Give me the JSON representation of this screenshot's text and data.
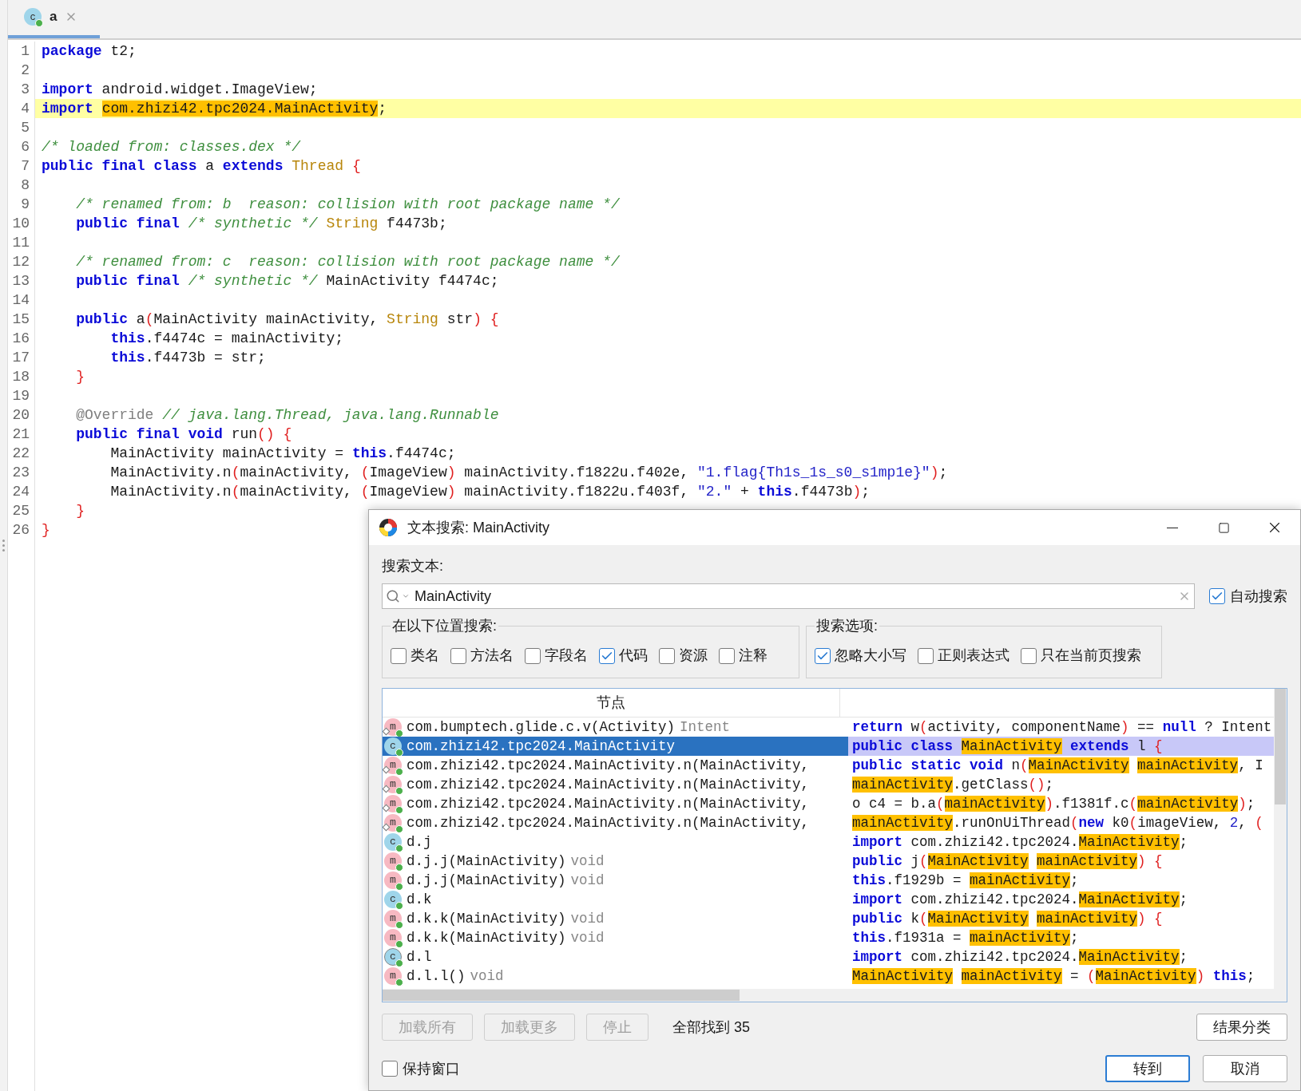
{
  "editor": {
    "tab": {
      "icon": "c",
      "label": "a",
      "selected": true
    },
    "lines": [
      {
        "number": "1",
        "highlighted": false,
        "tokens": [
          {
            "kind": "keyword",
            "text": "package"
          },
          {
            "kind": "plain",
            "text": " t2;"
          }
        ]
      },
      {
        "number": "2",
        "highlighted": false
      },
      {
        "number": "3",
        "highlighted": false,
        "tokens": [
          {
            "kind": "keyword",
            "text": "import"
          },
          {
            "kind": "plain",
            "text": " android.widget.ImageView;"
          }
        ]
      },
      {
        "number": "4",
        "highlighted": true,
        "tokens": [
          {
            "kind": "keyword",
            "text": "import "
          },
          {
            "kind": "match",
            "text": "com.zhizi42.tpc2024.MainActivity"
          },
          {
            "kind": "plain",
            "text": ";"
          }
        ]
      },
      {
        "number": "5",
        "highlighted": false
      },
      {
        "number": "6",
        "highlighted": false,
        "tokens": [
          {
            "kind": "comment",
            "text": "/* loaded from: classes.dex */"
          }
        ]
      },
      {
        "number": "7",
        "highlighted": false,
        "tokens": [
          {
            "kind": "keyword",
            "text": "public final class"
          },
          {
            "kind": "plain",
            "text": " a "
          },
          {
            "kind": "keyword",
            "text": "extends "
          },
          {
            "kind": "type",
            "text": "Thread "
          },
          {
            "kind": "brace",
            "text": "{"
          }
        ]
      },
      {
        "number": "8",
        "highlighted": false
      },
      {
        "number": "9",
        "highlighted": false,
        "tokens": [
          {
            "kind": "comment",
            "text": "    /* renamed from: b  reason: collision with root package name */"
          }
        ]
      },
      {
        "number": "10",
        "highlighted": false,
        "tokens": [
          {
            "kind": "keyword",
            "text": "    public final "
          },
          {
            "kind": "comment",
            "text": "/* synthetic */ "
          },
          {
            "kind": "type",
            "text": "String"
          },
          {
            "kind": "plain",
            "text": " f4473b;"
          }
        ]
      },
      {
        "number": "11",
        "highlighted": false
      },
      {
        "number": "12",
        "highlighted": false,
        "tokens": [
          {
            "kind": "comment",
            "text": "    /* renamed from: c  reason: collision with root package name */"
          }
        ]
      },
      {
        "number": "13",
        "highlighted": false,
        "tokens": [
          {
            "kind": "keyword",
            "text": "    public final "
          },
          {
            "kind": "comment",
            "text": "/* synthetic */"
          },
          {
            "kind": "plain",
            "text": " MainActivity f4474c;"
          }
        ]
      },
      {
        "number": "14",
        "highlighted": false
      },
      {
        "number": "15",
        "highlighted": false,
        "tokens": [
          {
            "kind": "keyword",
            "text": "    public"
          },
          {
            "kind": "plain",
            "text": " a"
          },
          {
            "kind": "brace",
            "text": "("
          },
          {
            "kind": "plain",
            "text": "MainActivity mainActivity, "
          },
          {
            "kind": "type",
            "text": "String"
          },
          {
            "kind": "plain",
            "text": " str"
          },
          {
            "kind": "brace",
            "text": ") {"
          }
        ]
      },
      {
        "number": "16",
        "highlighted": false,
        "tokens": [
          {
            "kind": "keyword",
            "text": "        this"
          },
          {
            "kind": "plain",
            "text": ".f4474c = mainActivity;"
          }
        ]
      },
      {
        "number": "17",
        "highlighted": false,
        "tokens": [
          {
            "kind": "keyword",
            "text": "        this"
          },
          {
            "kind": "plain",
            "text": ".f4473b = str;"
          }
        ]
      },
      {
        "number": "18",
        "highlighted": false,
        "tokens": [
          {
            "kind": "brace",
            "text": "    }"
          }
        ]
      },
      {
        "number": "19",
        "highlighted": false
      },
      {
        "number": "20",
        "highlighted": false,
        "tokens": [
          {
            "kind": "annotation",
            "text": "    @Override "
          },
          {
            "kind": "comment",
            "text": "// java.lang.Thread, java.lang.Runnable"
          }
        ]
      },
      {
        "number": "21",
        "highlighted": false,
        "tokens": [
          {
            "kind": "keyword",
            "text": "    public final void"
          },
          {
            "kind": "plain",
            "text": " run"
          },
          {
            "kind": "brace",
            "text": "() {"
          }
        ]
      },
      {
        "number": "22",
        "highlighted": false,
        "tokens": [
          {
            "kind": "plain",
            "text": "        MainActivity mainActivity = "
          },
          {
            "kind": "keyword",
            "text": "this"
          },
          {
            "kind": "plain",
            "text": ".f4474c;"
          }
        ]
      },
      {
        "number": "23",
        "highlighted": false,
        "tokens": [
          {
            "kind": "plain",
            "text": "        MainActivity.n"
          },
          {
            "kind": "brace",
            "text": "("
          },
          {
            "kind": "plain",
            "text": "mainActivity, "
          },
          {
            "kind": "brace",
            "text": "("
          },
          {
            "kind": "plain",
            "text": "ImageView"
          },
          {
            "kind": "brace",
            "text": ")"
          },
          {
            "kind": "plain",
            "text": " mainActivity.f1822u.f402e, "
          },
          {
            "kind": "string",
            "text": "\"1.flag{Th1s_1s_s0_s1mp1e}\""
          },
          {
            "kind": "brace",
            "text": ")"
          },
          {
            "kind": "plain",
            "text": ";"
          }
        ]
      },
      {
        "number": "24",
        "highlighted": false,
        "tokens": [
          {
            "kind": "plain",
            "text": "        MainActivity.n"
          },
          {
            "kind": "brace",
            "text": "("
          },
          {
            "kind": "plain",
            "text": "mainActivity, "
          },
          {
            "kind": "brace",
            "text": "("
          },
          {
            "kind": "plain",
            "text": "ImageView"
          },
          {
            "kind": "brace",
            "text": ")"
          },
          {
            "kind": "plain",
            "text": " mainActivity.f1822u.f403f, "
          },
          {
            "kind": "string",
            "text": "\"2.\""
          },
          {
            "kind": "plain",
            "text": " + "
          },
          {
            "kind": "keyword",
            "text": "this"
          },
          {
            "kind": "plain",
            "text": ".f4473b"
          },
          {
            "kind": "brace",
            "text": ")"
          },
          {
            "kind": "plain",
            "text": ";"
          }
        ]
      },
      {
        "number": "25",
        "highlighted": false,
        "tokens": [
          {
            "kind": "brace",
            "text": "    }"
          }
        ]
      },
      {
        "number": "26",
        "highlighted": false,
        "tokens": [
          {
            "kind": "brace",
            "text": "}"
          }
        ]
      }
    ]
  },
  "search_dialog": {
    "title": "文本搜索: MainActivity",
    "search_label": "搜索文本:",
    "search_field": {
      "value": "MainActivity"
    },
    "auto_search": {
      "label": "自动搜索",
      "checked": true
    },
    "scope_group": {
      "title": "在以下位置搜索:",
      "options": [
        {
          "label": "类名",
          "checked": false
        },
        {
          "label": "方法名",
          "checked": false
        },
        {
          "label": "字段名",
          "checked": false
        },
        {
          "label": "代码",
          "checked": true
        },
        {
          "label": "资源",
          "checked": false
        },
        {
          "label": "注释",
          "checked": false
        }
      ]
    },
    "options_group": {
      "title": "搜索选项:",
      "options": [
        {
          "label": "忽略大小写",
          "checked": true
        },
        {
          "label": "正则表达式",
          "checked": false
        },
        {
          "label": "只在当前页搜索",
          "checked": false
        }
      ]
    },
    "results": {
      "column_1": "节点",
      "rows": [
        {
          "kind": "static-method",
          "icon": "m",
          "node": "com.bumptech.glide.c.v(Activity)",
          "type": "Intent",
          "selected": false,
          "code": [
            {
              "kind": "keyword",
              "text": "return"
            },
            {
              "kind": "plain",
              "text": " w"
            },
            {
              "kind": "brace",
              "text": "("
            },
            {
              "kind": "plain",
              "text": "activity, componentName"
            },
            {
              "kind": "brace",
              "text": ")"
            },
            {
              "kind": "plain",
              "text": " == "
            },
            {
              "kind": "keyword",
              "text": "null"
            },
            {
              "kind": "plain",
              "text": " ? Intent"
            }
          ]
        },
        {
          "kind": "class",
          "icon": "c",
          "node": "com.zhizi42.tpc2024.MainActivity",
          "selected": true,
          "code": [
            {
              "kind": "keyword",
              "text": "public class "
            },
            {
              "kind": "match",
              "text": "MainActivity"
            },
            {
              "kind": "keyword",
              "text": " extends"
            },
            {
              "kind": "plain",
              "text": " l "
            },
            {
              "kind": "brace",
              "text": "{"
            }
          ]
        },
        {
          "kind": "static-method",
          "icon": "m",
          "node": "com.zhizi42.tpc2024.MainActivity.n(MainActivity,",
          "selected": false,
          "code": [
            {
              "kind": "keyword",
              "text": "public static void"
            },
            {
              "kind": "plain",
              "text": " n"
            },
            {
              "kind": "brace",
              "text": "("
            },
            {
              "kind": "match",
              "text": "MainActivity",
              "space_after": true
            },
            {
              "kind": "match",
              "text": "mainActivity"
            },
            {
              "kind": "plain",
              "text": ", I"
            }
          ]
        },
        {
          "kind": "static-method",
          "icon": "m",
          "node": "com.zhizi42.tpc2024.MainActivity.n(MainActivity,",
          "selected": false,
          "code": [
            {
              "kind": "match",
              "text": "mainActivity"
            },
            {
              "kind": "plain",
              "text": ".getClass"
            },
            {
              "kind": "brace",
              "text": "()"
            },
            {
              "kind": "plain",
              "text": ";"
            }
          ]
        },
        {
          "kind": "static-method",
          "icon": "m",
          "node": "com.zhizi42.tpc2024.MainActivity.n(MainActivity,",
          "selected": false,
          "code": [
            {
              "kind": "plain",
              "text": "o c4 = b.a"
            },
            {
              "kind": "brace",
              "text": "("
            },
            {
              "kind": "match",
              "text": "mainActivity"
            },
            {
              "kind": "brace",
              "text": ")"
            },
            {
              "kind": "plain",
              "text": ".f1381f.c"
            },
            {
              "kind": "brace",
              "text": "("
            },
            {
              "kind": "match",
              "text": "mainActivity"
            },
            {
              "kind": "brace",
              "text": ")"
            },
            {
              "kind": "plain",
              "text": ";"
            }
          ]
        },
        {
          "kind": "static-method",
          "icon": "m",
          "node": "com.zhizi42.tpc2024.MainActivity.n(MainActivity,",
          "selected": false,
          "code": [
            {
              "kind": "match",
              "text": "mainActivity"
            },
            {
              "kind": "plain",
              "text": ".runOnUiThread"
            },
            {
              "kind": "brace",
              "text": "("
            },
            {
              "kind": "keyword",
              "text": "new"
            },
            {
              "kind": "plain",
              "text": " k0"
            },
            {
              "kind": "brace",
              "text": "("
            },
            {
              "kind": "plain",
              "text": "imageView, "
            },
            {
              "kind": "number",
              "text": "2"
            },
            {
              "kind": "plain",
              "text": ", "
            },
            {
              "kind": "brace",
              "text": "("
            }
          ]
        },
        {
          "kind": "class",
          "icon": "c",
          "node": "d.j",
          "selected": false,
          "code": [
            {
              "kind": "keyword",
              "text": "import"
            },
            {
              "kind": "plain",
              "text": " com.zhizi42.tpc2024."
            },
            {
              "kind": "match",
              "text": "MainActivity"
            },
            {
              "kind": "plain",
              "text": ";"
            }
          ]
        },
        {
          "kind": "method",
          "icon": "m",
          "node": "d.j.j(MainActivity)",
          "type": "void",
          "selected": false,
          "code": [
            {
              "kind": "keyword",
              "text": "public"
            },
            {
              "kind": "plain",
              "text": " j"
            },
            {
              "kind": "brace",
              "text": "("
            },
            {
              "kind": "match",
              "text": "MainActivity",
              "space_after": true
            },
            {
              "kind": "match",
              "text": "mainActivity"
            },
            {
              "kind": "brace",
              "text": ") {"
            }
          ]
        },
        {
          "kind": "method",
          "icon": "m",
          "node": "d.j.j(MainActivity)",
          "type": "void",
          "selected": false,
          "code": [
            {
              "kind": "keyword",
              "text": "this"
            },
            {
              "kind": "plain",
              "text": ".f1929b = "
            },
            {
              "kind": "match",
              "text": "mainActivity"
            },
            {
              "kind": "plain",
              "text": ";"
            }
          ]
        },
        {
          "kind": "class",
          "icon": "c",
          "node": "d.k",
          "selected": false,
          "code": [
            {
              "kind": "keyword",
              "text": "import"
            },
            {
              "kind": "plain",
              "text": " com.zhizi42.tpc2024."
            },
            {
              "kind": "match",
              "text": "MainActivity"
            },
            {
              "kind": "plain",
              "text": ";"
            }
          ]
        },
        {
          "kind": "method",
          "icon": "m",
          "node": "d.k.k(MainActivity)",
          "type": "void",
          "selected": false,
          "code": [
            {
              "kind": "keyword",
              "text": "public"
            },
            {
              "kind": "plain",
              "text": " k"
            },
            {
              "kind": "brace",
              "text": "("
            },
            {
              "kind": "match",
              "text": "MainActivity",
              "space_after": true
            },
            {
              "kind": "match",
              "text": "mainActivity"
            },
            {
              "kind": "brace",
              "text": ") {"
            }
          ]
        },
        {
          "kind": "method",
          "icon": "m",
          "node": "d.k.k(MainActivity)",
          "type": "void",
          "selected": false,
          "code": [
            {
              "kind": "keyword",
              "text": "this"
            },
            {
              "kind": "plain",
              "text": ".f1931a = "
            },
            {
              "kind": "match",
              "text": "mainActivity"
            },
            {
              "kind": "plain",
              "text": ";"
            }
          ]
        },
        {
          "kind": "abstract-class",
          "icon": "c",
          "node": "d.l",
          "selected": false,
          "code": [
            {
              "kind": "keyword",
              "text": "import"
            },
            {
              "kind": "plain",
              "text": " com.zhizi42.tpc2024."
            },
            {
              "kind": "match",
              "text": "MainActivity"
            },
            {
              "kind": "plain",
              "text": ";"
            }
          ]
        },
        {
          "kind": "method",
          "icon": "m",
          "node": "d.l.l()",
          "type": "void",
          "selected": false,
          "code": [
            {
              "kind": "match",
              "text": "MainActivity",
              "space_after": true
            },
            {
              "kind": "match",
              "text": "mainActivity"
            },
            {
              "kind": "plain",
              "text": " = "
            },
            {
              "kind": "brace",
              "text": "("
            },
            {
              "kind": "match",
              "text": "MainActivity"
            },
            {
              "kind": "brace",
              "text": ")"
            },
            {
              "kind": "keyword",
              "text": " this"
            },
            {
              "kind": "plain",
              "text": ";"
            }
          ]
        }
      ]
    },
    "load_buttons": [
      {
        "label": "加载所有",
        "disabled": true
      },
      {
        "label": "加载更多",
        "disabled": true
      },
      {
        "label": "停止",
        "disabled": true
      }
    ],
    "found_text": "全部找到 35",
    "group_button": {
      "label": "结果分类"
    },
    "keep_window": {
      "label": "保持窗口",
      "checked": false
    },
    "footer_buttons": [
      {
        "label": "转到",
        "default": true
      },
      {
        "label": "取消",
        "default": false
      }
    ]
  }
}
